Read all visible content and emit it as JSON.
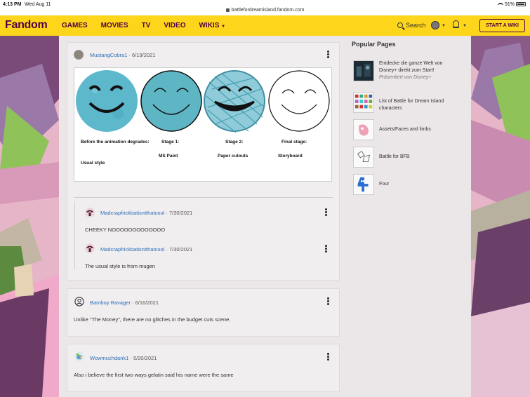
{
  "status_bar": {
    "time": "4:13 PM",
    "date": "Wed Aug 11",
    "url": "battlefordreamisland.fandom.com",
    "battery": "91%"
  },
  "nav": {
    "logo": "Fandom",
    "links": [
      "GAMES",
      "MOVIES",
      "TV",
      "VIDEO",
      "WIKIS"
    ],
    "search_label": "Search",
    "start_wiki": "START A WIKI"
  },
  "post": {
    "user": "MustangCobra1",
    "date": "· 6/19/2021",
    "image_labels": {
      "col1_title": "Before the animation degrades:",
      "col1_sub": "Usual style",
      "col2_title": "Stage 1:",
      "col2_sub": "MS Paint",
      "col3_title": "Stage 2:",
      "col3_sub": "Paper cutouts",
      "col4_title": "Final stage:",
      "col4_sub": "Storyboard"
    }
  },
  "replies": [
    {
      "user": "Madcrapfrickbatisntthatcool",
      "date": "· 7/30/2021",
      "text": "CHEEKY NOOOOOOOOOOOOO"
    },
    {
      "user": "Madcrapfrickbatisntthatcool",
      "date": "· 7/30/2021",
      "text": "The usual style is from mugen"
    }
  ],
  "comments": [
    {
      "user": "Bamboy Ravager",
      "date": "· 6/16/2021",
      "text": "Unlike \"The Money\", there are no glitches in the budget cuts scene."
    },
    {
      "user": "Wowmuchdank1",
      "date": "· 5/20/2021",
      "text": "Also i believe the first two ways gelatin said his name were the same"
    }
  ],
  "popular": {
    "title": "Popular Pages",
    "items": [
      {
        "title": "Entdecke die ganze Welt von Disney+ direkt zum Start!",
        "subtitle": "Präsentiert von Disney+"
      },
      {
        "title": "List of Battle for Dream Island characters"
      },
      {
        "title": "Assets/Faces and limbs"
      },
      {
        "title": "Battle for BFB"
      },
      {
        "title": "Four"
      }
    ]
  },
  "colors": {
    "nav_bg": "#fdd51a",
    "brand": "#520044",
    "link": "#2a6fb7"
  }
}
